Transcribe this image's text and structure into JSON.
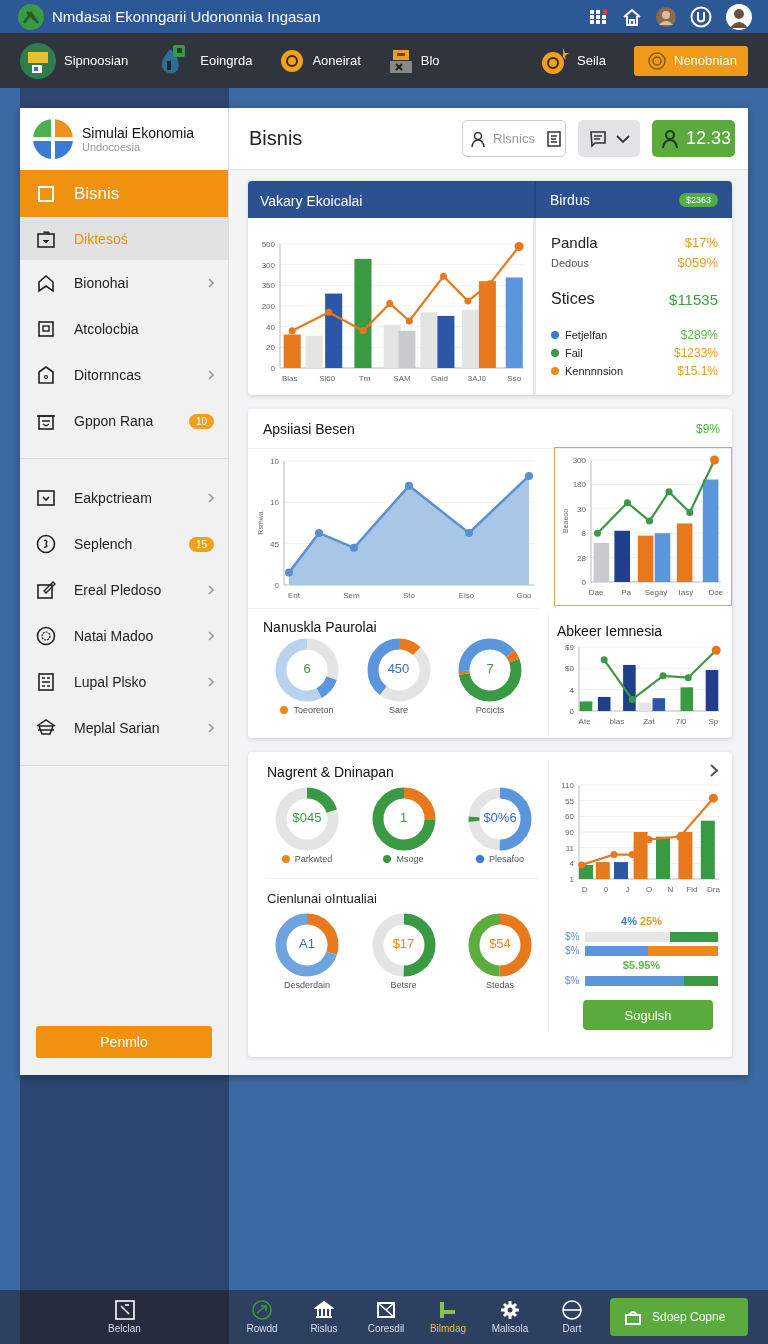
{
  "app_bar": {
    "title": "Nmdasai Ekonngarii Udononnia Ingasan"
  },
  "nav": {
    "items": [
      {
        "label": "Sipnoosian"
      },
      {
        "label": "Eoingrda"
      },
      {
        "label": "Aoneirat"
      },
      {
        "label": "Blo"
      }
    ],
    "account": "Seila",
    "button": "Nenobnian"
  },
  "sidebar": {
    "title": "Simulai Ekonomia",
    "subtitle": "Undocoesia",
    "sections": [
      [
        {
          "label": "Bisnis",
          "selected": true,
          "highlighted": false,
          "chevron": false
        },
        {
          "label": "Diktesoś",
          "selected": false,
          "highlighted": true,
          "chevron": false
        },
        {
          "label": "Bionohai",
          "selected": false,
          "highlighted": false,
          "chevron": true
        },
        {
          "label": "Atcolocbia",
          "selected": false,
          "highlighted": false,
          "chevron": false
        },
        {
          "label": "Ditornncas",
          "selected": false,
          "highlighted": false,
          "chevron": true
        },
        {
          "label": "Gppon Rana",
          "selected": false,
          "highlighted": false,
          "chevron": false,
          "badge": "10"
        }
      ],
      [
        {
          "label": "Eakpctrieam",
          "selected": false,
          "highlighted": false,
          "chevron": true
        },
        {
          "label": "Seplench",
          "selected": false,
          "highlighted": false,
          "chevron": false,
          "badge": "15"
        },
        {
          "label": "Ereal Pledoso",
          "selected": false,
          "highlighted": false,
          "chevron": true
        },
        {
          "label": "Natai Madoo",
          "selected": false,
          "highlighted": false,
          "chevron": true
        },
        {
          "label": "Lupal Plsko",
          "selected": false,
          "highlighted": false,
          "chevron": true
        },
        {
          "label": "Meplal Sarian",
          "selected": false,
          "highlighted": false,
          "chevron": true
        }
      ]
    ],
    "button": "Penmlo"
  },
  "main": {
    "title": "Bisnis",
    "search": {
      "placeholder": "Rlsnics"
    },
    "score_button": "12.33",
    "overview": {
      "title": "Vakary Ekoicalai",
      "chart": {
        "y_labels": [
          "500",
          "300",
          "350",
          "200",
          "40",
          "20",
          "0"
        ],
        "x_labels": [
          "Blas",
          "Sl60",
          "Tm",
          "SAM",
          "Gaid",
          "3AJ0",
          "Sso"
        ]
      },
      "side_title": "Birdus",
      "side_badge": "$2363",
      "stats": [
        {
          "label": "Pandla",
          "value": "$17%",
          "kind": "major"
        },
        {
          "label": "Dedous",
          "value": "$059%",
          "kind": "minor"
        },
        {
          "label": "Stices",
          "value": "$11535",
          "kind": "total"
        }
      ],
      "legend": [
        {
          "label": "Fetjelfan",
          "color": "#3a7bd5",
          "value": {
            "text": "$289%",
            "color": "#5cb848"
          }
        },
        {
          "label": "Fail",
          "color": "#3a9a43",
          "value": {
            "text": "$1233%",
            "color": "#ea9a1e"
          }
        },
        {
          "label": "Kennnnsion",
          "color": "#ea8a1e",
          "value": {
            "text": "$15.1%",
            "color": "#ea9a1e"
          }
        }
      ]
    },
    "appreciation": {
      "title": "Apsiiasi Besen",
      "change": "$9%",
      "area_chart": {
        "ylabel": "Rsmwa",
        "y_labels": [
          "10",
          "10",
          "45",
          "0"
        ],
        "x_labels": [
          "Ent",
          "Sem",
          "Sto",
          "Eiso",
          "Goo"
        ]
      },
      "bar_chart": {
        "ylabel": "Beaeoo",
        "y_labels": [
          "300",
          "180",
          "30",
          "8",
          "28",
          "0"
        ],
        "x_labels": [
          "Dae",
          "Pa",
          "Segay",
          "Iasy",
          "Doe"
        ],
        "selected": true
      },
      "donut_title": "Nanuskla Paurolai",
      "donuts": [
        {
          "value": "6",
          "color": "#3a9a43",
          "label": "Toeoreton",
          "legend_dot": {
            "color": "#ea8a1e"
          }
        },
        {
          "value": "450",
          "color": "#3a6fc0",
          "label": "Sare"
        },
        {
          "value": "7",
          "color": "#3a9a43",
          "label": "Pccicts"
        }
      ],
      "mini_title": "Abkeer Iemnesia",
      "mini_chart": {
        "y_labels": [
          "$9",
          "$0",
          "4",
          "0"
        ],
        "x_labels": [
          "Ate",
          "blas",
          "Zat",
          "7l0",
          "Sp"
        ]
      }
    },
    "management": {
      "title": "Nagrent & Dninapan",
      "donuts": [
        {
          "value": "$045",
          "color": "#3a9a43",
          "label": "Parkwted",
          "legend_dot": {
            "color": "#ea8a1e"
          }
        },
        {
          "value": "1",
          "color": "#3a9a43",
          "label": "Msoge",
          "legend_dot": {
            "color": "#3a9a43"
          }
        },
        {
          "value": "$0%6",
          "color": "#3a6fc0",
          "label": "Plesafoo",
          "legend_dot": {
            "color": "#3a7bd5"
          }
        }
      ],
      "chart": {
        "y_labels": [
          "110",
          "55",
          "60",
          "90",
          "11",
          "4",
          "1"
        ],
        "x_labels": [
          "D",
          "0",
          "J",
          "O",
          "N",
          "Fid",
          "Dra"
        ]
      },
      "sub_title": "Cienlunai oIntualiai",
      "donuts2": [
        {
          "value": "A1",
          "color": "#3a6fc0",
          "label": "Desderdain"
        },
        {
          "value": "$17",
          "color": "#ea8a1e",
          "label": "Betsre"
        },
        {
          "value": "$54",
          "color": "#ea8a1e",
          "label": "Stedas"
        }
      ],
      "progress": [
        {
          "kind": "caption",
          "parts": [
            {
              "text": "4%",
              "color": "#3a7bd5"
            },
            {
              "text": "25%",
              "color": "#ea9a1e"
            }
          ]
        },
        {
          "kind": "bar",
          "label": "$%",
          "level": 0.64,
          "color": "#e6e6e6",
          "rest": {
            "color": "#3a9a43"
          }
        },
        {
          "kind": "bar",
          "label": "$%",
          "level": 0.47,
          "color": "#5b95db",
          "rest": {
            "color": "#ea8a1e"
          }
        },
        {
          "kind": "caption",
          "parts": [
            {
              "text": "$5.95%",
              "color": "#5cb848"
            }
          ]
        },
        {
          "kind": "bar",
          "label": "$%",
          "level": 0.74,
          "color": "#5b95db",
          "rest": {
            "color": "#3a9a43"
          }
        }
      ],
      "button": "Sogulsh"
    }
  },
  "bottom_bar": {
    "left": "Belclan",
    "items": [
      {
        "label": "Rowdd",
        "selected": false
      },
      {
        "label": "Rislus",
        "selected": false
      },
      {
        "label": "Coresdil",
        "selected": false
      },
      {
        "label": "Bilmdag",
        "selected": true
      },
      {
        "label": "Malisola",
        "selected": false
      },
      {
        "label": "Dart",
        "selected": false
      }
    ],
    "button": "Sdoep Copne"
  }
}
